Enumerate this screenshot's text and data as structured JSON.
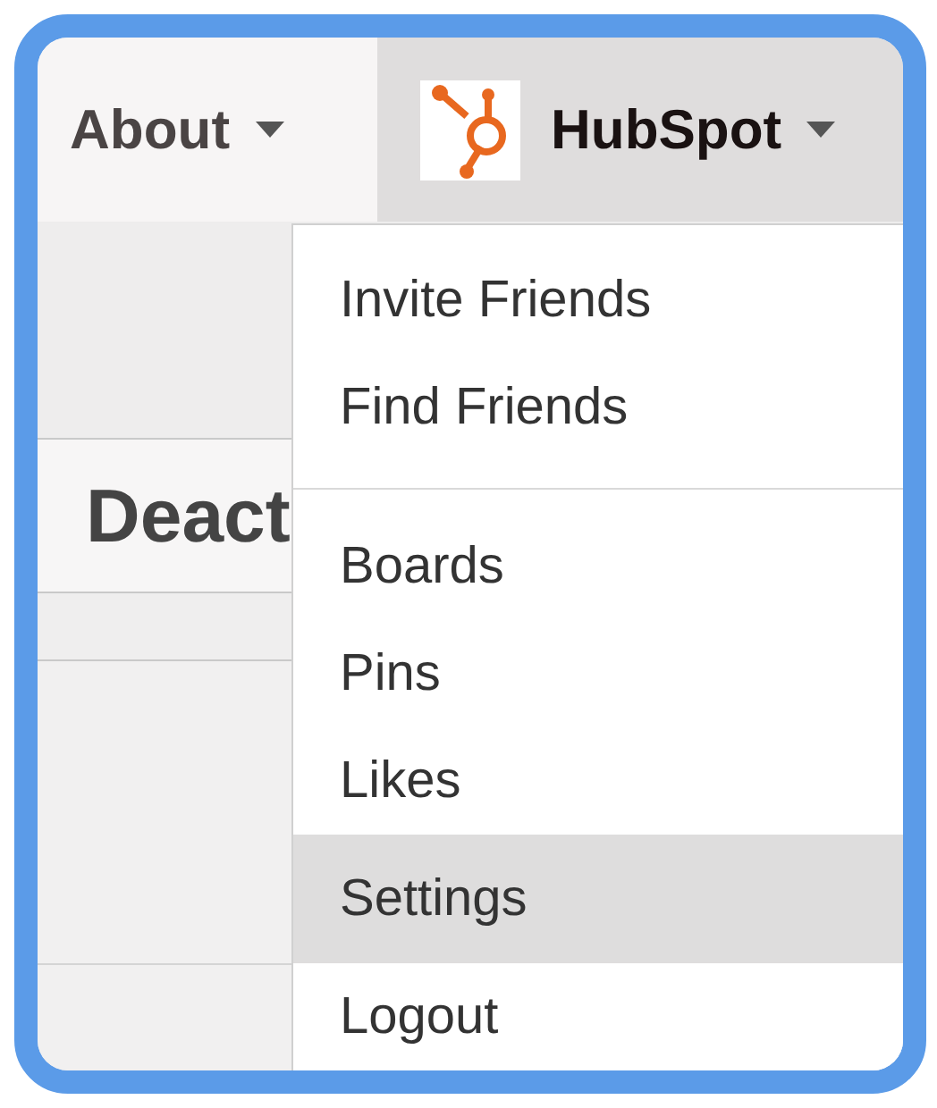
{
  "nav": [
    {
      "kind": "text",
      "label": "About",
      "active": false
    },
    {
      "kind": "logo",
      "label": "HubSpot",
      "active": true
    }
  ],
  "page": {
    "heading": "Deact"
  },
  "menu": {
    "groups": [
      {
        "items": [
          {
            "label": "Invite Friends",
            "selected": false
          },
          {
            "label": "Find Friends",
            "selected": false
          }
        ]
      },
      {
        "items": [
          {
            "label": "Boards",
            "selected": false
          },
          {
            "label": "Pins",
            "selected": false
          },
          {
            "label": "Likes",
            "selected": false
          },
          {
            "label": "Settings",
            "selected": true
          },
          {
            "label": "Logout",
            "selected": false
          }
        ]
      }
    ]
  }
}
